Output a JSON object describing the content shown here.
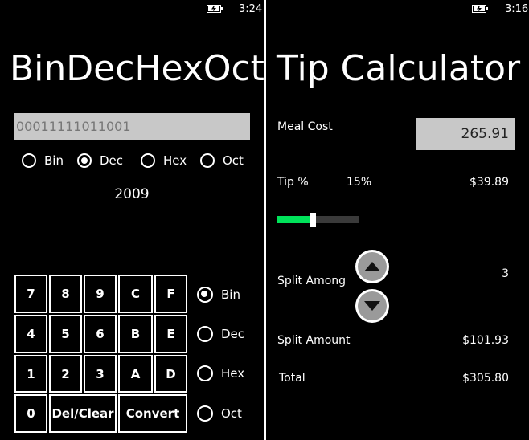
{
  "left_app": {
    "status": {
      "time": "3:24"
    },
    "title": "BinDecHexOct",
    "input_value": "00011111011001",
    "input_mode_options": [
      {
        "label": "Bin",
        "selected": false
      },
      {
        "label": "Dec",
        "selected": true
      },
      {
        "label": "Hex",
        "selected": false
      },
      {
        "label": "Oct",
        "selected": false
      }
    ],
    "result": "2009",
    "keypad": [
      "7",
      "8",
      "9",
      "C",
      "F",
      "4",
      "5",
      "6",
      "B",
      "E",
      "1",
      "2",
      "3",
      "A",
      "D",
      "0",
      "Del/Clear",
      "Convert"
    ],
    "output_mode_options": [
      {
        "label": "Bin",
        "selected": true
      },
      {
        "label": "Dec",
        "selected": false
      },
      {
        "label": "Hex",
        "selected": false
      },
      {
        "label": "Oct",
        "selected": false
      }
    ]
  },
  "right_app": {
    "status": {
      "time": "3:16"
    },
    "title": "Tip Calculator",
    "meal_cost_label": "Meal Cost",
    "meal_cost_value": "265.91",
    "tip_label": "Tip %",
    "tip_percent": "15%",
    "tip_amount": "$39.89",
    "tip_slider_fraction": 0.43,
    "split_among_label": "Split Among",
    "split_among_value": "3",
    "split_amount_label": "Split Amount",
    "split_amount_value": "$101.93",
    "total_label": "Total",
    "total_value": "$305.80",
    "colors": {
      "slider_accent": "#00e35a",
      "input_bg": "#c8c8c8"
    }
  }
}
